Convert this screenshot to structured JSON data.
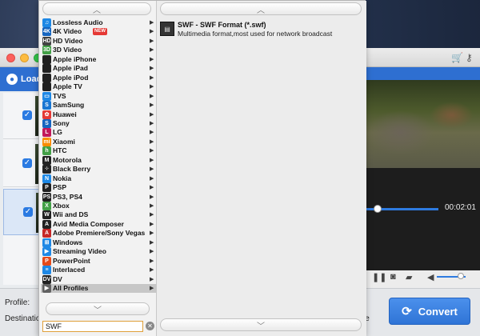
{
  "app": {
    "toolbar": {
      "load_label": "Load D"
    },
    "bottom": {
      "profile_label": "Profile:",
      "destination_label": "Destination:",
      "stub": "le"
    },
    "player": {
      "time": "00:02:01"
    },
    "convert_label": "Convert"
  },
  "popup": {
    "categories": [
      {
        "label": "Lossless Audio",
        "icon": "music-icon",
        "color": "#1e88e5"
      },
      {
        "label": "4K Video",
        "icon": "4k-icon",
        "color": "#1565c0",
        "badge": "NEW"
      },
      {
        "label": "HD Video",
        "icon": "hd-icon",
        "color": "#424242"
      },
      {
        "label": "3D Video",
        "icon": "3d-icon",
        "color": "#43a047"
      },
      {
        "label": "Apple iPhone",
        "icon": "iphone-icon",
        "color": "#212121"
      },
      {
        "label": "Apple iPad",
        "icon": "ipad-icon",
        "color": "#212121"
      },
      {
        "label": "Apple iPod",
        "icon": "ipod-icon",
        "color": "#212121"
      },
      {
        "label": "Apple TV",
        "icon": "apple-tv-icon",
        "color": "#212121"
      },
      {
        "label": "TVS",
        "icon": "tv-icon",
        "color": "#1e88e5"
      },
      {
        "label": "SamSung",
        "icon": "samsung-icon",
        "color": "#1976d2"
      },
      {
        "label": "Huawei",
        "icon": "huawei-icon",
        "color": "#e53935"
      },
      {
        "label": "Sony",
        "icon": "sony-icon",
        "color": "#1565c0"
      },
      {
        "label": "LG",
        "icon": "lg-icon",
        "color": "#c2185b"
      },
      {
        "label": "Xiaomi",
        "icon": "xiaomi-icon",
        "color": "#fb8c00"
      },
      {
        "label": "HTC",
        "icon": "htc-icon",
        "color": "#43a047"
      },
      {
        "label": "Motorola",
        "icon": "motorola-icon",
        "color": "#212121"
      },
      {
        "label": "Black Berry",
        "icon": "blackberry-icon",
        "color": "#212121"
      },
      {
        "label": "Nokia",
        "icon": "nokia-icon",
        "color": "#1e88e5"
      },
      {
        "label": "PSP",
        "icon": "psp-icon",
        "color": "#212121"
      },
      {
        "label": "PS3, PS4",
        "icon": "playstation-icon",
        "color": "#212121"
      },
      {
        "label": "Xbox",
        "icon": "xbox-icon",
        "color": "#43a047"
      },
      {
        "label": "Wii and DS",
        "icon": "wii-icon",
        "color": "#212121"
      },
      {
        "label": "Avid Media Composer",
        "icon": "avid-icon",
        "color": "#212121"
      },
      {
        "label": "Adobe Premiere/Sony Vegas",
        "icon": "adobe-icon",
        "color": "#c62828"
      },
      {
        "label": "Windows",
        "icon": "windows-icon",
        "color": "#1e88e5"
      },
      {
        "label": "Streaming Video",
        "icon": "streaming-icon",
        "color": "#1e88e5"
      },
      {
        "label": "PowerPoint",
        "icon": "powerpoint-icon",
        "color": "#e64a19"
      },
      {
        "label": "Interlaced",
        "icon": "interlaced-icon",
        "color": "#1e88e5"
      },
      {
        "label": "DV",
        "icon": "dv-icon",
        "color": "#212121"
      },
      {
        "label": "All Profiles",
        "icon": "play-icon",
        "color": "#616161",
        "selected": true
      }
    ],
    "format": {
      "name": "SWF - SWF Format (*.swf)",
      "description": "Multimedia format,most used for network broadcast"
    },
    "search": {
      "value": "SWF"
    }
  }
}
